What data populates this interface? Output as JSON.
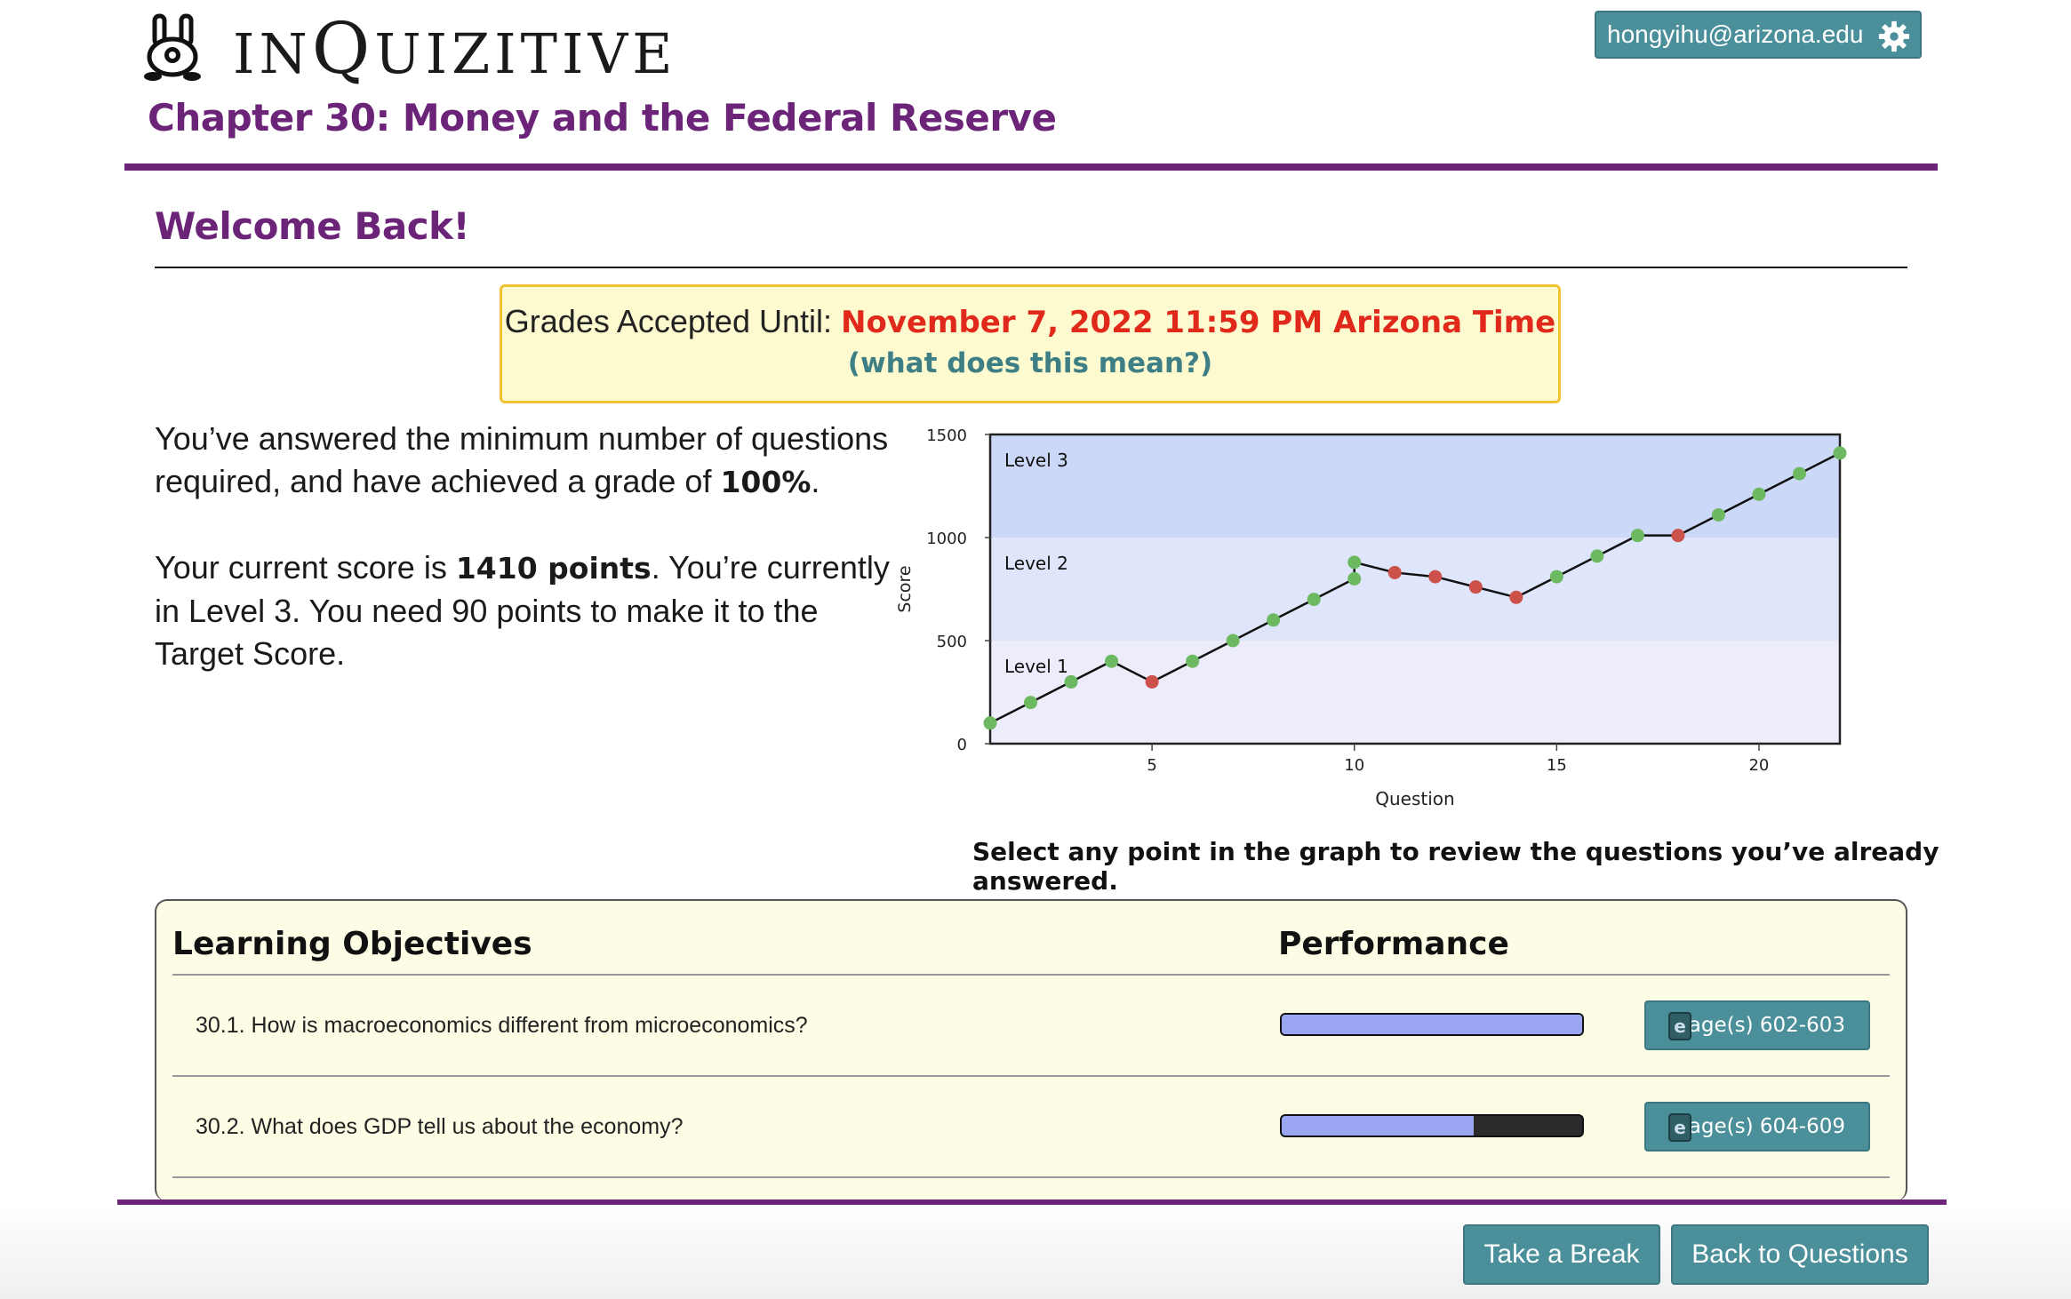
{
  "header": {
    "logo_text_small_1": "IN",
    "logo_text_big": "Q",
    "logo_text_small_2": "UIZITIVE",
    "user_email": "hongyihu@arizona.edu",
    "settings_icon": "gear-icon",
    "chapter_title": "Chapter 30: Money and the Federal Reserve"
  },
  "welcome": {
    "title": "Welcome Back!"
  },
  "grades": {
    "label": "Grades Accepted Until: ",
    "deadline": "November 7, 2022 11:59 PM Arizona Time",
    "help_link": "(what does this mean?)"
  },
  "summary": {
    "p1_pre": "You’ve answered the minimum number of questions required, and have achieved a grade of ",
    "p1_grade": "100%",
    "p1_post": ".",
    "p2_pre": "Your current score is ",
    "p2_score": "1410 points",
    "p2_post": ". You’re currently in Level 3. You need 90 points to make it to the Target Score."
  },
  "chart_data": {
    "type": "line",
    "xlabel": "Question",
    "ylabel": "Score",
    "xlim": [
      1,
      22
    ],
    "ylim": [
      0,
      1500
    ],
    "xticks": [
      5,
      10,
      15,
      20
    ],
    "yticks": [
      0,
      500,
      1000,
      1500
    ],
    "levels": [
      {
        "name": "Level 1",
        "from": 0,
        "to": 500,
        "color": "#ececfb"
      },
      {
        "name": "Level 2",
        "from": 500,
        "to": 1000,
        "color": "#dfe6fb"
      },
      {
        "name": "Level 3",
        "from": 1000,
        "to": 1500,
        "color": "#cbd8f8"
      }
    ],
    "points": [
      {
        "x": 1,
        "y": 100,
        "correct": true
      },
      {
        "x": 2,
        "y": 200,
        "correct": true
      },
      {
        "x": 3,
        "y": 300,
        "correct": true
      },
      {
        "x": 4,
        "y": 400,
        "correct": true
      },
      {
        "x": 5,
        "y": 300,
        "correct": false
      },
      {
        "x": 6,
        "y": 400,
        "correct": true
      },
      {
        "x": 7,
        "y": 500,
        "correct": true
      },
      {
        "x": 8,
        "y": 600,
        "correct": true
      },
      {
        "x": 9,
        "y": 700,
        "correct": true
      },
      {
        "x": 10,
        "y": 800,
        "correct": true
      },
      {
        "x": 10,
        "y": 880,
        "correct": true
      },
      {
        "x": 11,
        "y": 830,
        "correct": false
      },
      {
        "x": 12,
        "y": 810,
        "correct": false
      },
      {
        "x": 13,
        "y": 760,
        "correct": false
      },
      {
        "x": 14,
        "y": 710,
        "correct": false
      },
      {
        "x": 15,
        "y": 810,
        "correct": true
      },
      {
        "x": 16,
        "y": 910,
        "correct": true
      },
      {
        "x": 17,
        "y": 1010,
        "correct": true
      },
      {
        "x": 18,
        "y": 1010,
        "correct": false
      },
      {
        "x": 19,
        "y": 1110,
        "correct": true
      },
      {
        "x": 20,
        "y": 1210,
        "correct": true
      },
      {
        "x": 21,
        "y": 1310,
        "correct": true
      },
      {
        "x": 22,
        "y": 1410,
        "correct": true
      }
    ],
    "colors": {
      "correct": "#6cb961",
      "incorrect": "#cc514b",
      "line": "#111111"
    }
  },
  "select_hint": "Select any point in the graph to review the questions you’ve already answered.",
  "objectives": {
    "header_objectives": "Learning Objectives",
    "header_performance": "Performance",
    "items": [
      {
        "text": "30.1. How is macroeconomics different from microeconomics?",
        "performance": 1.0,
        "pages": "Page(s) 602-603",
        "icon": "ebook-icon"
      },
      {
        "text": "30.2. What does GDP tell us about the economy?",
        "performance": 0.64,
        "pages": "Page(s) 604-609",
        "icon": "ebook-icon"
      }
    ]
  },
  "footer": {
    "take_break": "Take a Break",
    "back_to_questions": "Back to Questions"
  },
  "colors": {
    "brand_purple": "#6b2478",
    "button_teal": "#4a8f99",
    "deadline_red": "#e0291b"
  }
}
